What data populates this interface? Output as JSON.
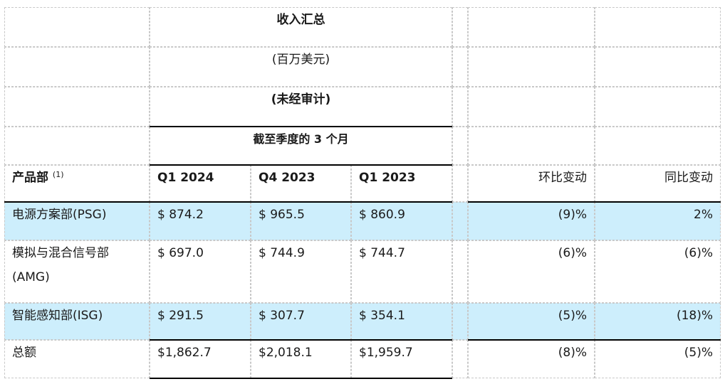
{
  "table": {
    "title": "收入汇总",
    "unit": "(百万美元)",
    "audit": "(未经审计)",
    "period": "截至季度的 3 个月",
    "headers": {
      "segment": "产品部",
      "segment_note": "(1)",
      "q1_2024": "Q1 2024",
      "q4_2023": "Q4 2023",
      "q1_2023": "Q1 2023",
      "qoq": "环比变动",
      "yoy": "同比变动"
    },
    "rows": [
      {
        "segment": "电源方案部(PSG)",
        "q1_2024": "$ 874.2",
        "q4_2023": "$ 965.5",
        "q1_2023": "$ 860.9",
        "qoq": "(9)%",
        "yoy": "2%"
      },
      {
        "segment_line1": "模拟与混合信号部",
        "segment_line2": "(AMG)",
        "q1_2024": "$ 697.0",
        "q4_2023": "$ 744.9",
        "q1_2023": "$ 744.7",
        "qoq": "(6)%",
        "yoy": "(6)%"
      },
      {
        "segment": "智能感知部(ISG)",
        "q1_2024": "$ 291.5",
        "q4_2023": "$ 307.7",
        "q1_2023": "$ 354.1",
        "qoq": "(5)%",
        "yoy": "(18)%"
      },
      {
        "segment": "总额",
        "q1_2024": "$1,862.7",
        "q4_2023": "$2,018.1",
        "q1_2023": "$1,959.7",
        "qoq": "(8)%",
        "yoy": "(5)%"
      }
    ]
  },
  "colors": {
    "highlight": "#cdeefc",
    "rule": "#000000",
    "grid": "#c8c8c8"
  }
}
